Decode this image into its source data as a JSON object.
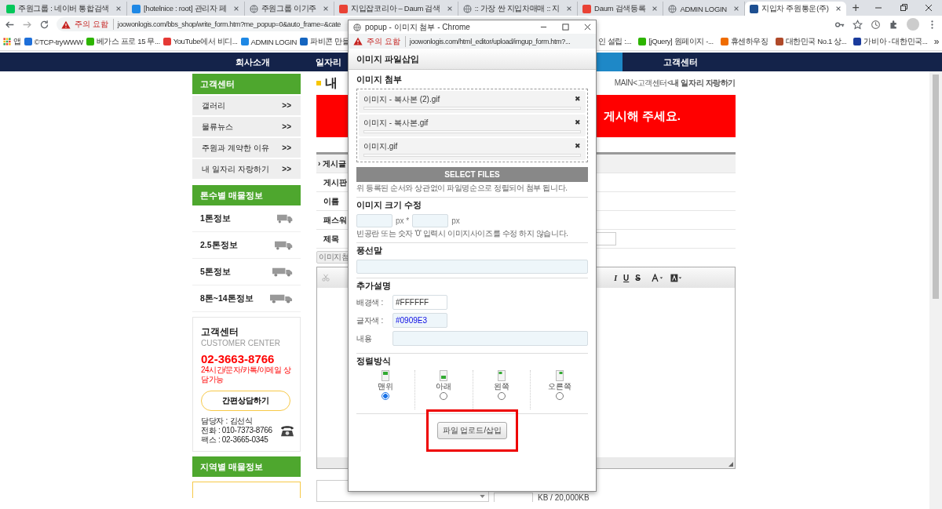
{
  "browser": {
    "tabs": [
      {
        "label": "주원그룹 : 네이버 통합검색",
        "selected": false
      },
      {
        "label": "[hotelnice : root] 관리자 페",
        "selected": false
      },
      {
        "label": "주원그룹 이기주",
        "selected": false
      },
      {
        "label": "지입잡코리아 – Daum 검색",
        "selected": false
      },
      {
        "label": ":: 가장 싼 지입차매매 :: 지",
        "selected": false
      },
      {
        "label": "Daum 검색등록",
        "selected": false
      },
      {
        "label": "ADMIN LOGIN",
        "selected": false
      },
      {
        "label": "지입차 주원통운(주)",
        "selected": true
      }
    ],
    "new_tab": "+",
    "address": {
      "security": "주의 요함",
      "url": "joowonlogis.com/bbs_shop/write_form.htm?me_popup=0&auto_frame=&cate"
    },
    "bookmarks": [
      "앱",
      "©TCP-tryWWW",
      "베가스 프로 15 무...",
      "YouTube에서 비디...",
      "ADMIN LOGIN",
      "파비콘 만들"
    ],
    "bookmarks_right": [
      "인 설립 :...",
      "[jQuery] 원페이지 -...",
      "휴센하우징",
      "대한민국 No.1 상...",
      "가비아 - 대한민국..."
    ],
    "more": "»"
  },
  "site": {
    "nav": [
      {
        "label": "회사소개"
      },
      {
        "label": "일자리"
      },
      {
        "label": "고객센터"
      }
    ],
    "sidebar": {
      "menus": [
        {
          "title": "고객센터",
          "kind": "links",
          "items": [
            {
              "label": "갤러리",
              "arrow": ">>"
            },
            {
              "label": "물류뉴스",
              "arrow": ">>"
            },
            {
              "label": "주원과 계약한 이유",
              "arrow": ">>"
            },
            {
              "label": "내 일자리 자랑하기",
              "arrow": ">>"
            }
          ]
        },
        {
          "title": "톤수별 매물정보",
          "kind": "trucks",
          "items": [
            {
              "label": "1톤정보"
            },
            {
              "label": "2.5톤정보"
            },
            {
              "label": "5톤정보"
            },
            {
              "label": "8톤~14톤정보"
            }
          ]
        }
      ],
      "contact": {
        "title": "고객센터",
        "subtitle": "CUSTOMER CENTER",
        "phone": "02-3663-8766",
        "hours": "24시간/문자/카톡/이메일 상담가능",
        "button": "간편상담하기",
        "lines": [
          "담당자 : 김선식",
          "전화 : 010-7373-8766",
          "팩스 : 02-3665-0345"
        ]
      },
      "region_title": "지역별 매물정보"
    },
    "main": {
      "heading": "내",
      "breadcrumb": "MAIN<고객센터<**내 일자리 자랑하기**",
      "banner": "게시해 주세요.",
      "form_rows": [
        "› 게시글",
        "게시판",
        "이름",
        "패스워",
        "제목"
      ],
      "attach_button": "이미지첨",
      "toolbar": [
        "I",
        "U",
        "S"
      ],
      "size_label": "KB / 20,000KB"
    }
  },
  "popup": {
    "title": "popup - 이미지 첨부 - Chrome",
    "security": "주의 요함",
    "url": "joowonlogis.com/html_editor/upload/imgup_form.htm?...",
    "header": "이미지 파일삽입",
    "attach_title": "이미지 첨부",
    "files": [
      {
        "name": "이미지 - 복사본 (2).gif",
        "remove": "✖",
        "level": 0
      },
      {
        "name": "이미지 - 복사본.gif",
        "remove": "✖",
        "level": 0
      },
      {
        "name": "이미지.gif",
        "remove": "✖",
        "level": 0
      }
    ],
    "select_button": "SELECT FILES",
    "attach_note": "위 등록된 순서와 상관없이 파일명순으로 정렬되어 첨부 됩니다.",
    "resize_title": "이미지 크기 수정",
    "unit_x": "px *",
    "unit": "px",
    "resize_note": "빈공란 또는 숫자 '0' 입력시 이미지사이즈를 수정 하지 않습니다.",
    "balloon_title": "풍선말",
    "extra_title": "추가설명",
    "extra_fields": [
      {
        "label": "배경색 :",
        "value": "#FFFFFF",
        "kind": "short"
      },
      {
        "label": "글자색 :",
        "value": "#0909E3",
        "kind": "short"
      },
      {
        "label": "내용",
        "kind": "wide"
      }
    ],
    "align_title": "정렬방식",
    "align_options": [
      {
        "label": "맨위",
        "selected": true
      },
      {
        "label": "아래",
        "selected": false
      },
      {
        "label": "왼쪽",
        "selected": false
      },
      {
        "label": "오른쪽",
        "selected": false
      }
    ],
    "upload_button": "파일 업로드/삽입"
  }
}
